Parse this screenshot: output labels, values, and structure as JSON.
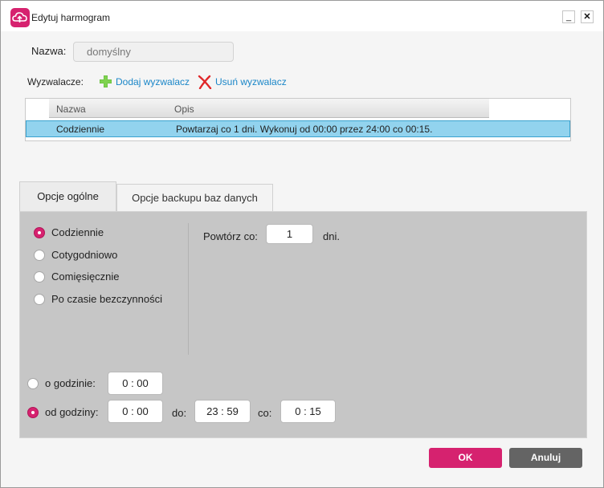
{
  "window": {
    "title": "Edytuj harmogram",
    "minimize_glyph": "_",
    "close_glyph": "✕",
    "icon": "cloud-upload-icon"
  },
  "name_field": {
    "label": "Nazwa:",
    "value": "domyślny"
  },
  "triggers": {
    "label": "Wyzwalacze:",
    "add_label": "Dodaj wyzwalacz",
    "remove_label": "Usuń wyzwalacz",
    "columns": [
      "Nazwa",
      "Opis"
    ],
    "rows": [
      {
        "name": "Codziennie",
        "description": "Powtarzaj co 1 dni. Wykonuj od 00:00 przez 24:00 co 00:15."
      }
    ]
  },
  "tabs": [
    {
      "label": "Opcje ogólne",
      "active": true
    },
    {
      "label": "Opcje backupu baz danych",
      "active": false
    }
  ],
  "frequency": {
    "options": [
      {
        "label": "Codziennie",
        "checked": true
      },
      {
        "label": "Cotygodniowo",
        "checked": false
      },
      {
        "label": "Comięsięcznie",
        "checked": false
      },
      {
        "label": "Po czasie bezczynności",
        "checked": false
      }
    ],
    "repeat_label": "Powtórz co:",
    "repeat_value": "1",
    "repeat_unit": "dni."
  },
  "time": {
    "at_label": "o godzinie:",
    "at_value": "0 : 00",
    "at_checked": false,
    "from_label": "od godziny:",
    "from_value": "0 : 00",
    "from_checked": true,
    "to_label": "do:",
    "to_value": "23 : 59",
    "every_label": "co:",
    "every_value": "0 : 15"
  },
  "buttons": {
    "ok": "OK",
    "cancel": "Anuluj"
  },
  "colors": {
    "accent": "#d6226f",
    "link": "#1a86c8",
    "selected_row": "#92d3ee",
    "cancel": "#646464"
  }
}
